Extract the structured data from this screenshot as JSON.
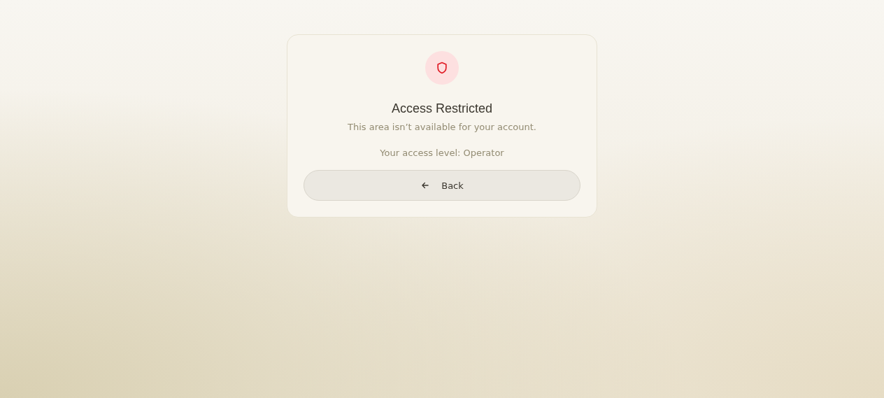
{
  "card": {
    "title": "Access Restricted",
    "message": "This area isn’t available for your account.",
    "access_level": "Your access level: Operator",
    "button": {
      "label": "Back"
    }
  }
}
